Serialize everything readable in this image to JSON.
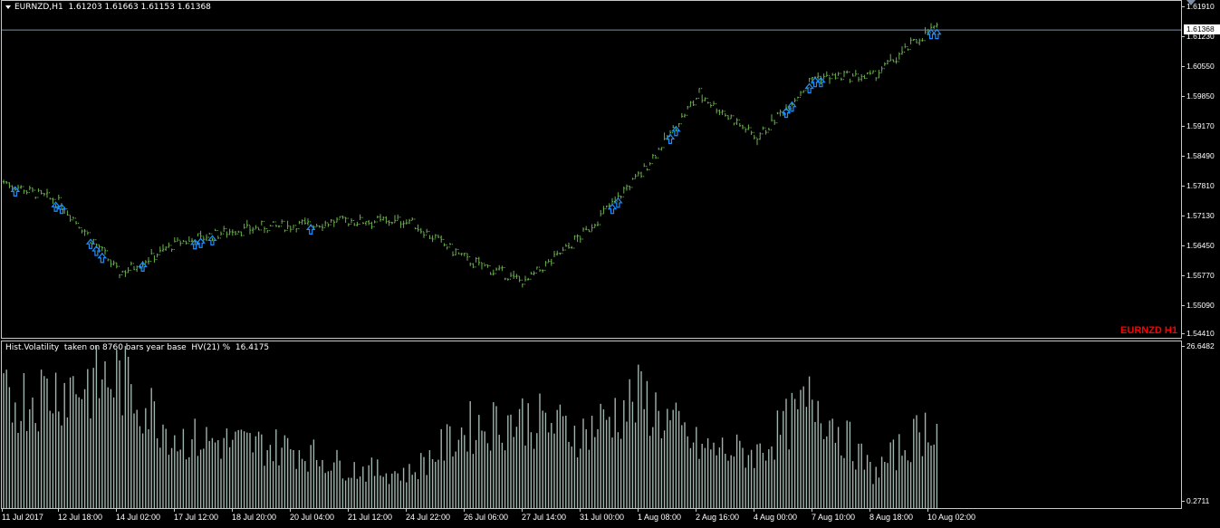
{
  "window": {
    "symbol": "EURNZD,H1",
    "ohlc": "1.61203 1.61663 1.61153 1.61368",
    "corner_label": "EURNZD H1"
  },
  "colors": {
    "bars": "#6ab04c",
    "signal_arrow": "#1e90ff",
    "hv_bars": "#9fb3ad",
    "bid_line": "#7d8fa8",
    "symbol_label": "#ff0000",
    "grid_border": "#c8c8c8"
  },
  "price_scale": {
    "current": "1.61368",
    "ticks": [
      "1.61910",
      "1.61230",
      "1.60550",
      "1.59850",
      "1.59170",
      "1.58490",
      "1.57810",
      "1.57130",
      "1.56450",
      "1.55770",
      "1.55090",
      "1.54410"
    ]
  },
  "indicator": {
    "header": "Hist.Volatility  taken on 8760 bars year base  HV(21) %  16.4175",
    "scale_top": "26.6482",
    "scale_bottom": "0.2711"
  },
  "time_axis": [
    "11 Jul 2017",
    "12 Jul 18:00",
    "14 Jul 02:00",
    "17 Jul 12:00",
    "18 Jul 20:00",
    "20 Jul 04:00",
    "21 Jul 12:00",
    "24 Jul 22:00",
    "26 Jul 06:00",
    "27 Jul 14:00",
    "31 Jul 00:00",
    "1 Aug 08:00",
    "2 Aug 16:00",
    "4 Aug 00:00",
    "7 Aug 10:00",
    "8 Aug 18:00",
    "10 Aug 02:00"
  ],
  "chart_data": [
    {
      "type": "line",
      "title": "EURNZD,H1",
      "ylim": [
        1.5441,
        1.6191
      ],
      "x": [
        "11 Jul 2017",
        "12 Jul 18:00",
        "14 Jul 02:00",
        "17 Jul 12:00",
        "18 Jul 20:00",
        "20 Jul 04:00",
        "21 Jul 12:00",
        "24 Jul 22:00",
        "26 Jul 06:00",
        "27 Jul 14:00",
        "31 Jul 00:00",
        "1 Aug 08:00",
        "2 Aug 16:00",
        "4 Aug 00:00",
        "7 Aug 10:00",
        "8 Aug 18:00",
        "10 Aug 02:00"
      ],
      "series": [
        {
          "name": "EURNZD",
          "values": [
            1.579,
            1.574,
            1.558,
            1.565,
            1.568,
            1.569,
            1.57,
            1.57,
            1.561,
            1.556,
            1.567,
            1.581,
            1.599,
            1.589,
            1.603,
            1.603,
            1.614
          ]
        }
      ]
    },
    {
      "type": "bar",
      "title": "Hist.Volatility  taken on 8760 bars year base  HV(21) %  16.4175",
      "ylim": [
        0.2711,
        26.6482
      ],
      "x": [
        "11 Jul 2017",
        "12 Jul 18:00",
        "14 Jul 02:00",
        "17 Jul 12:00",
        "18 Jul 20:00",
        "20 Jul 04:00",
        "21 Jul 12:00",
        "24 Jul 22:00",
        "26 Jul 06:00",
        "27 Jul 14:00",
        "31 Jul 00:00",
        "1 Aug 08:00",
        "2 Aug 16:00",
        "4 Aug 00:00",
        "7 Aug 10:00",
        "8 Aug 18:00",
        "10 Aug 02:00"
      ],
      "series": [
        {
          "name": "HV(21) %",
          "values": [
            21,
            24,
            26,
            14,
            13,
            12,
            8,
            7,
            16,
            18,
            15,
            22,
            12,
            11,
            22,
            7,
            17
          ]
        }
      ]
    }
  ]
}
